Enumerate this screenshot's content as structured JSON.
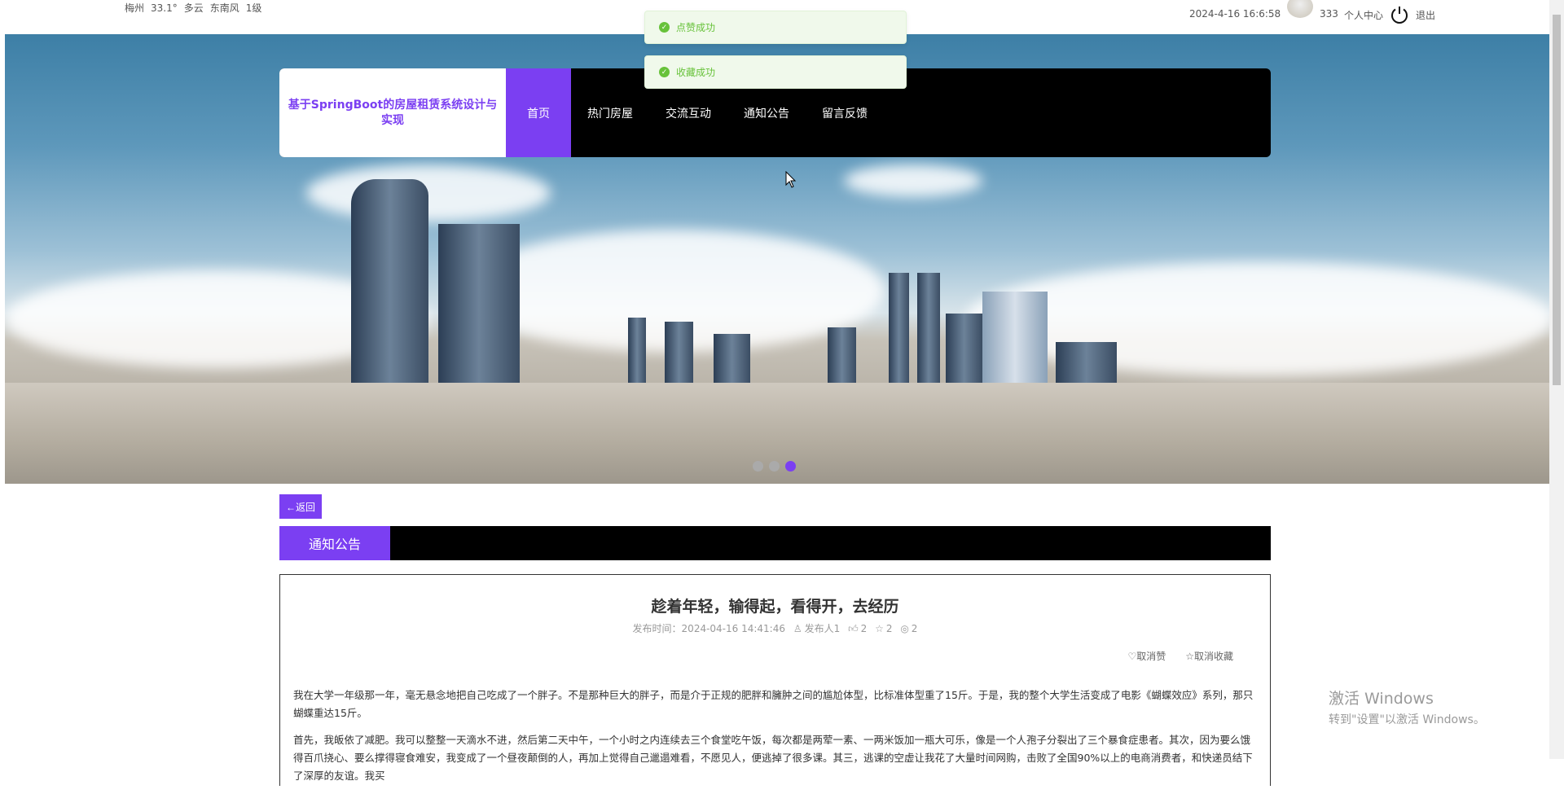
{
  "topbar": {
    "weather": {
      "city": "梅州",
      "temp": "33.1°",
      "condition": "多云",
      "wind": "东南风",
      "level": "1级"
    },
    "datetime": "2024-4-16 16:6:58",
    "username": "333",
    "profile_label": "个人中心",
    "logout_label": "退出"
  },
  "toasts": [
    {
      "text": "点赞成功",
      "icon": "check-circle-icon"
    },
    {
      "text": "收藏成功",
      "icon": "check-circle-icon"
    }
  ],
  "nav": {
    "logo": "基于SpringBoot的房屋租赁系统设计与实现",
    "items": [
      {
        "label": "首页",
        "active": true
      },
      {
        "label": "热门房屋"
      },
      {
        "label": "交流互动"
      },
      {
        "label": "通知公告"
      },
      {
        "label": "留言反馈"
      }
    ]
  },
  "carousel": {
    "slides": 3,
    "active": 3
  },
  "back_label": "←返回",
  "section_title": "通知公告",
  "article": {
    "title": "趁着年轻，输得起，看得开，去经历",
    "publish_time": "发布时间：2024-04-16 14:41:46",
    "author": "发布人1",
    "likes": "2",
    "favorites": "2",
    "views": "2",
    "unlike_label": "取消赞",
    "unfavorite_label": "取消收藏",
    "paragraphs": [
      "我在大学一年级那一年，毫无悬念地把自己吃成了一个胖子。不是那种巨大的胖子，而是介于正规的肥胖和臃肿之间的尴尬体型，比标准体型重了15斤。于是，我的整个大学生活变成了电影《蝴蝶效应》系列，那只蝴蝶重达15斤。",
      "首先，我皈依了减肥。我可以整整一天滴水不进，然后第二天中午，一个小时之内连续去三个食堂吃午饭，每次都是两荤一素、一两米饭加一瓶大可乐，像是一个人孢子分裂出了三个暴食症患者。其次，因为要么饿得百爪挠心、要么撑得寝食难安，我变成了一个昼夜颠倒的人，再加上觉得自己邋遢难看，不愿见人，便逃掉了很多课。其三，逃课的空虚让我花了大量时间网购，击败了全国90%以上的电商消费者，和快递员结下了深厚的友谊。我买"
    ]
  },
  "watermark": {
    "line1": "激活 Windows",
    "line2": "转到\"设置\"以激活 Windows。"
  }
}
